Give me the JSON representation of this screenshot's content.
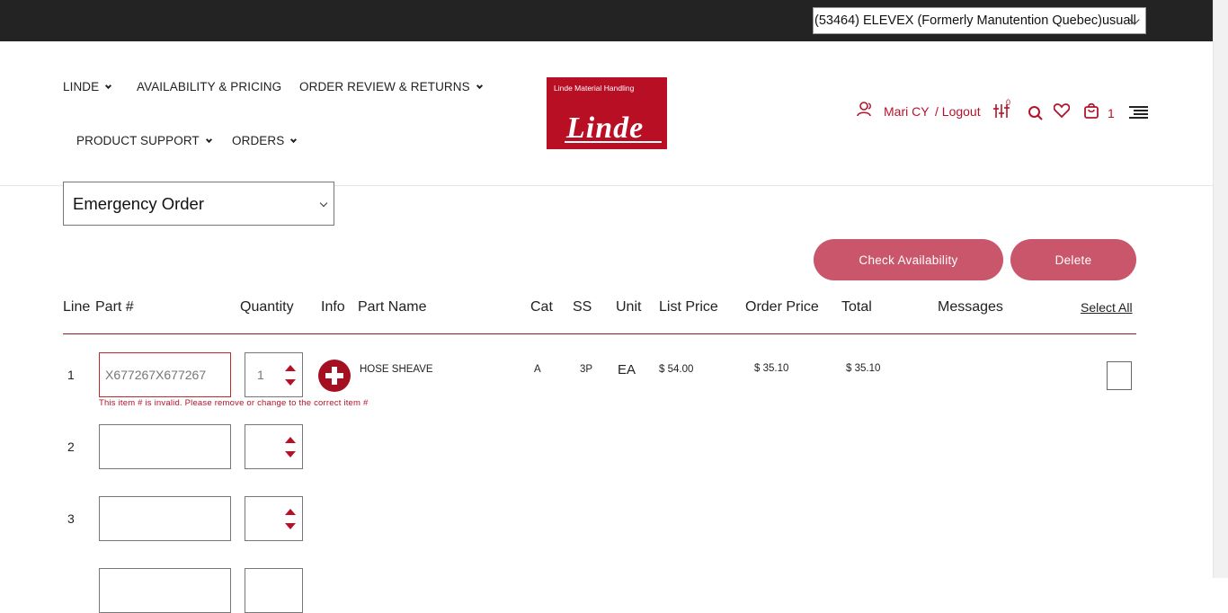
{
  "topbar": {
    "account_selected": "(53464) ELEVEX (Formerly Manutention Quebec)usuall"
  },
  "nav": [
    {
      "label": "LINDE"
    },
    {
      "label": "AVAILABILITY & PRICING"
    },
    {
      "label": "ORDER REVIEW & RETURNS"
    },
    {
      "label": "PRODUCT SUPPORT"
    },
    {
      "label": "ORDERS"
    }
  ],
  "logo": {
    "small_text": "Linde Material Handling",
    "brand": "Linde"
  },
  "user": {
    "name": "Mari CY",
    "logout": "/ Logout",
    "compare_count": "0",
    "cart_count": "1"
  },
  "order_type": {
    "selected": "Emergency Order"
  },
  "actions": {
    "check_availability": "Check Availability",
    "delete": "Delete"
  },
  "table": {
    "headers": {
      "line": "Line",
      "part": "Part #",
      "quantity": "Quantity",
      "info": "Info",
      "part_name": "Part Name",
      "cat": "Cat",
      "ss": "SS",
      "unit": "Unit",
      "list_price": "List Price",
      "order_price": "Order Price",
      "total": "Total",
      "messages": "Messages",
      "select_all": "Select All"
    },
    "rows": [
      {
        "line": "1",
        "part": "X677267X677267",
        "quantity": "1",
        "part_name": "HOSE SHEAVE",
        "cat": "A",
        "ss": "3P",
        "unit": "EA",
        "list_price": "$ 54.00",
        "order_price": "$ 35.10",
        "total": "$ 35.10",
        "error": "This item # is invalid. Please remove or change to the correct item #"
      },
      {
        "line": "2",
        "part": "",
        "quantity": ""
      },
      {
        "line": "3",
        "part": "",
        "quantity": ""
      }
    ]
  },
  "colors": {
    "brand_red": "#b90f25",
    "button_pink": "#c9566b",
    "topbar": "#232323"
  }
}
